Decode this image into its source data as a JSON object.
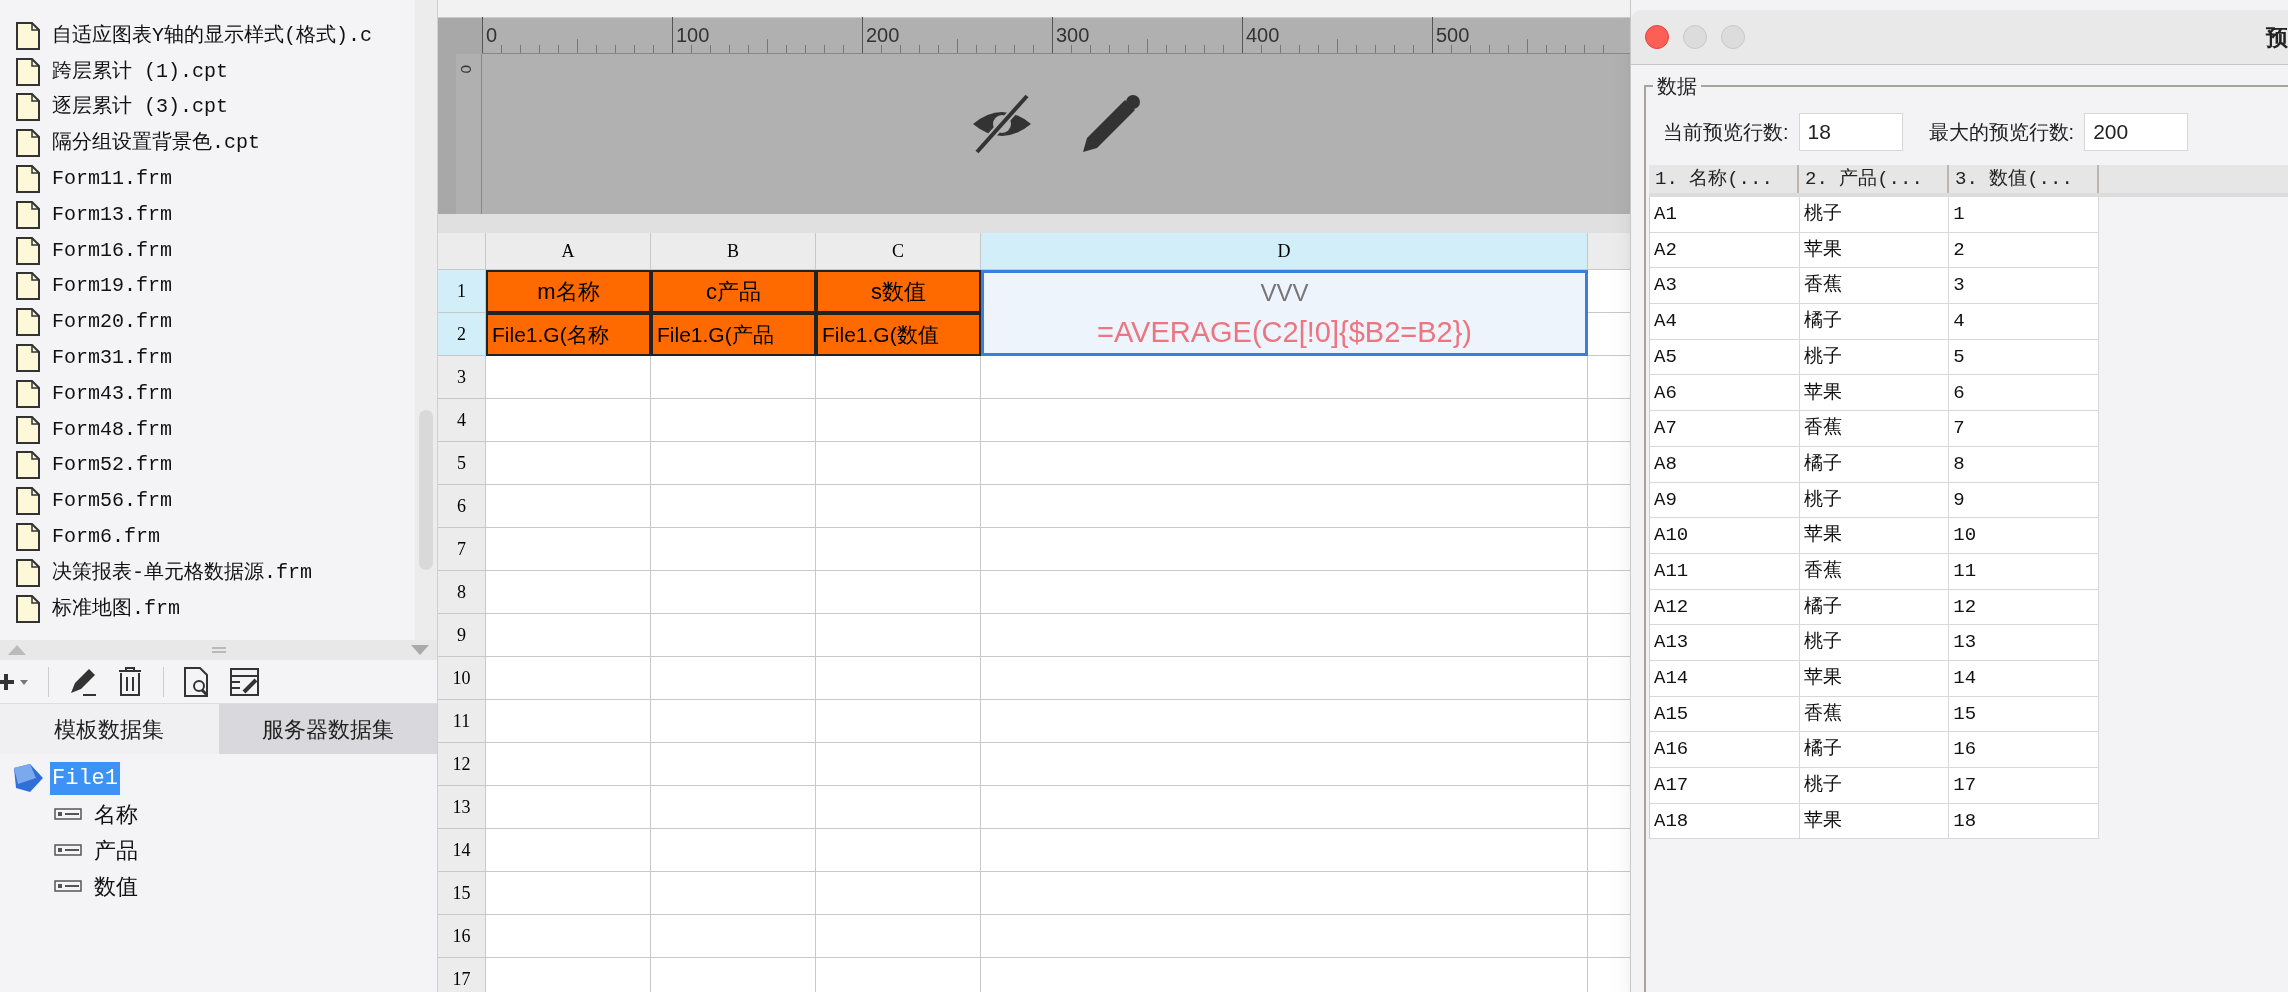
{
  "files": [
    {
      "name": "自适应图表Y轴的显示样式(格式).c"
    },
    {
      "name": "跨层累计 (1).cpt"
    },
    {
      "name": "逐层累计 (3).cpt"
    },
    {
      "name": "隔分组设置背景色.cpt"
    },
    {
      "name": "Form11.frm"
    },
    {
      "name": "Form13.frm"
    },
    {
      "name": "Form16.frm"
    },
    {
      "name": "Form19.frm"
    },
    {
      "name": "Form20.frm"
    },
    {
      "name": "Form31.frm"
    },
    {
      "name": "Form43.frm"
    },
    {
      "name": "Form48.frm"
    },
    {
      "name": "Form52.frm"
    },
    {
      "name": "Form56.frm"
    },
    {
      "name": "Form6.frm"
    },
    {
      "name": "决策报表-单元格数据源.frm"
    },
    {
      "name": "标准地图.frm"
    }
  ],
  "dataset_tabs": [
    {
      "label": "模板数据集",
      "selected": true
    },
    {
      "label": "服务器数据集",
      "selected": false
    }
  ],
  "dataset_tree": [
    {
      "label": "File1",
      "selected": true,
      "children": [
        {
          "label": "名称"
        },
        {
          "label": "产品"
        },
        {
          "label": "数值"
        }
      ]
    }
  ],
  "ruler": {
    "ticks": [
      "0",
      "100",
      "200",
      "300",
      "400",
      "500"
    ],
    "vertical_tick": "0"
  },
  "sheet": {
    "columns": [
      {
        "label": "A",
        "selected": false
      },
      {
        "label": "B",
        "selected": false
      },
      {
        "label": "C",
        "selected": false
      },
      {
        "label": "D",
        "selected": true
      }
    ],
    "rows": [
      {
        "label": "1",
        "selected": true,
        "cells": [
          {
            "text": "m名称",
            "kind": "header"
          },
          {
            "text": "c产品",
            "kind": "header"
          },
          {
            "text": "s数值",
            "kind": "header"
          },
          {
            "text": "VVV",
            "kind": "selected_title"
          }
        ]
      },
      {
        "label": "2",
        "selected": true,
        "cells": [
          {
            "text": "File1.G(名称",
            "kind": "field"
          },
          {
            "text": "File1.G(产品",
            "kind": "field"
          },
          {
            "text": "File1.G(数值",
            "kind": "field"
          },
          {
            "text": "=AVERAGE(C2[!0]{$B2=B2})",
            "kind": "formula"
          }
        ]
      },
      {
        "label": "3",
        "selected": false
      },
      {
        "label": "4",
        "selected": false
      },
      {
        "label": "5",
        "selected": false
      },
      {
        "label": "6",
        "selected": false
      },
      {
        "label": "7",
        "selected": false
      },
      {
        "label": "8",
        "selected": false
      },
      {
        "label": "9",
        "selected": false
      },
      {
        "label": "10",
        "selected": false
      },
      {
        "label": "11",
        "selected": false
      },
      {
        "label": "12",
        "selected": false
      },
      {
        "label": "13",
        "selected": false
      },
      {
        "label": "14",
        "selected": false
      },
      {
        "label": "15",
        "selected": false
      },
      {
        "label": "16",
        "selected": false
      },
      {
        "label": "17",
        "selected": false
      }
    ]
  },
  "preview_dialog": {
    "title": "预",
    "group_label": "数据",
    "current_rows_label": "当前预览行数:",
    "current_rows": "18",
    "max_rows_label": "最大的预览行数:",
    "max_rows": "200",
    "columns": [
      "1. 名称(...",
      "2. 产品(...",
      "3. 数值(..."
    ],
    "rows": [
      [
        "A1",
        "桃子",
        "1"
      ],
      [
        "A2",
        "苹果",
        "2"
      ],
      [
        "A3",
        "香蕉",
        "3"
      ],
      [
        "A4",
        "橘子",
        "4"
      ],
      [
        "A5",
        "桃子",
        "5"
      ],
      [
        "A6",
        "苹果",
        "6"
      ],
      [
        "A7",
        "香蕉",
        "7"
      ],
      [
        "A8",
        "橘子",
        "8"
      ],
      [
        "A9",
        "桃子",
        "9"
      ],
      [
        "A10",
        "苹果",
        "10"
      ],
      [
        "A11",
        "香蕉",
        "11"
      ],
      [
        "A12",
        "橘子",
        "12"
      ],
      [
        "A13",
        "桃子",
        "13"
      ],
      [
        "A14",
        "苹果",
        "14"
      ],
      [
        "A15",
        "香蕉",
        "15"
      ],
      [
        "A16",
        "橘子",
        "16"
      ],
      [
        "A17",
        "桃子",
        "17"
      ],
      [
        "A18",
        "苹果",
        "18"
      ]
    ]
  }
}
